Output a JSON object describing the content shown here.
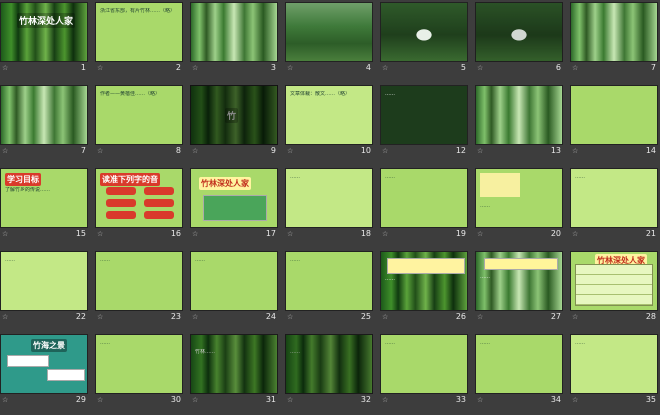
{
  "slides": [
    {
      "number": "1",
      "kind": "title-bamboo",
      "text": "竹林深处人家"
    },
    {
      "number": "2",
      "kind": "text-green",
      "text": "浙江省东部，有片竹林……（略）"
    },
    {
      "number": "3",
      "kind": "bamboo-bright"
    },
    {
      "number": "4",
      "kind": "forest"
    },
    {
      "number": "5",
      "kind": "waterfall"
    },
    {
      "number": "6",
      "kind": "waterfall"
    },
    {
      "number": "7",
      "kind": "bamboo-bright"
    },
    {
      "number": "8",
      "kind": "text-green",
      "text": "作者——黄蓓佳……（略）"
    },
    {
      "number": "9",
      "kind": "bamboo-dark"
    },
    {
      "number": "10",
      "kind": "text-green",
      "text": "文章体裁：散文……（略）"
    },
    {
      "number": "11",
      "kind": "bamboo-dark-text",
      "text": "竹"
    },
    {
      "number": "12",
      "kind": "text-dark",
      "text": "……"
    },
    {
      "number": "13",
      "kind": "text-light",
      "text": "……"
    },
    {
      "number": "14",
      "kind": "bamboo-bright"
    },
    {
      "number": "15",
      "kind": "text-green",
      "text": "……"
    },
    {
      "number": "16",
      "kind": "text-green-title",
      "title": "学习目标",
      "text": "了解竹乡的传说……"
    },
    {
      "number": "17",
      "kind": "red-list",
      "title": "读准下列字的音"
    },
    {
      "number": "18",
      "kind": "title-red",
      "title": "竹林深处人家"
    },
    {
      "number": "19",
      "kind": "text-green",
      "text": "……"
    },
    {
      "number": "20",
      "kind": "yellow-questions",
      "text": "……"
    },
    {
      "number": "21",
      "kind": "text-light",
      "text": "……"
    },
    {
      "number": "22",
      "kind": "text-light",
      "text": "……"
    },
    {
      "number": "23",
      "kind": "text-green",
      "text": "……"
    },
    {
      "number": "24",
      "kind": "text-green",
      "text": "……"
    },
    {
      "number": "25",
      "kind": "text-green",
      "text": "……"
    },
    {
      "number": "26",
      "kind": "bamboo-text",
      "text": "……"
    },
    {
      "number": "27",
      "kind": "bamboo-text",
      "text": "……"
    },
    {
      "number": "28",
      "kind": "table",
      "title": "竹林深处人家"
    },
    {
      "number": "29",
      "kind": "teal-board",
      "title": "竹海之景"
    },
    {
      "number": "30",
      "kind": "text-green",
      "text": "……"
    },
    {
      "number": "31",
      "kind": "bamboo-dark-text",
      "text": "竹林……"
    },
    {
      "number": "32",
      "kind": "bamboo-dark-text",
      "text": "……"
    },
    {
      "number": "33",
      "kind": "text-green",
      "text": "……"
    },
    {
      "number": "34",
      "kind": "text-green",
      "text": "……"
    },
    {
      "number": "35",
      "kind": "text-green",
      "text": "……"
    }
  ]
}
